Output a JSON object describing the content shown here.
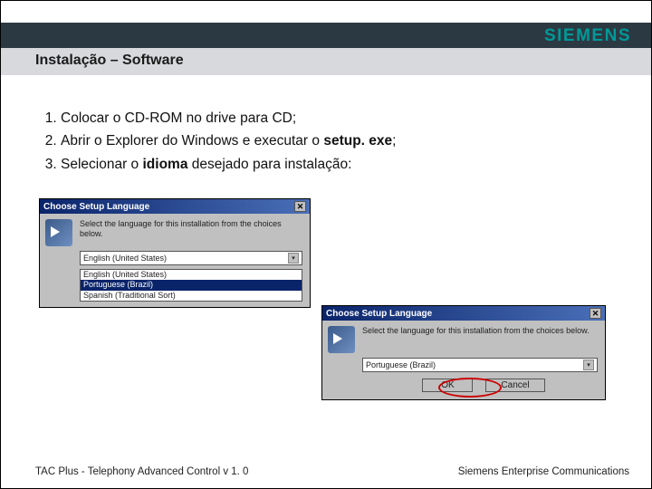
{
  "logo": "SIEMENS",
  "page_title": "Instalação – Software",
  "steps": {
    "s1a": "Colocar o CD-ROM no drive para CD;",
    "s2a": "Abrir o Explorer do Windows e executar o ",
    "s2b": "setup. exe",
    "s2c": ";",
    "s3a": "Selecionar o ",
    "s3b": "idioma",
    "s3c": " desejado para instalação:"
  },
  "dlg1": {
    "title": "Choose Setup Language",
    "instr": "Select the language for this installation from the choices below.",
    "selected": "English (United States)",
    "opts": [
      "English (United States)",
      "Portuguese (Brazil)",
      "Spanish (Traditional Sort)"
    ]
  },
  "dlg2": {
    "title": "Choose Setup Language",
    "instr": "Select the language for this installation from the choices below.",
    "selected": "Portuguese (Brazil)",
    "ok": "OK",
    "cancel": "Cancel"
  },
  "footer": {
    "left": "TAC Plus - Telephony Advanced Control v 1. 0",
    "right": "Siemens Enterprise Communications"
  }
}
